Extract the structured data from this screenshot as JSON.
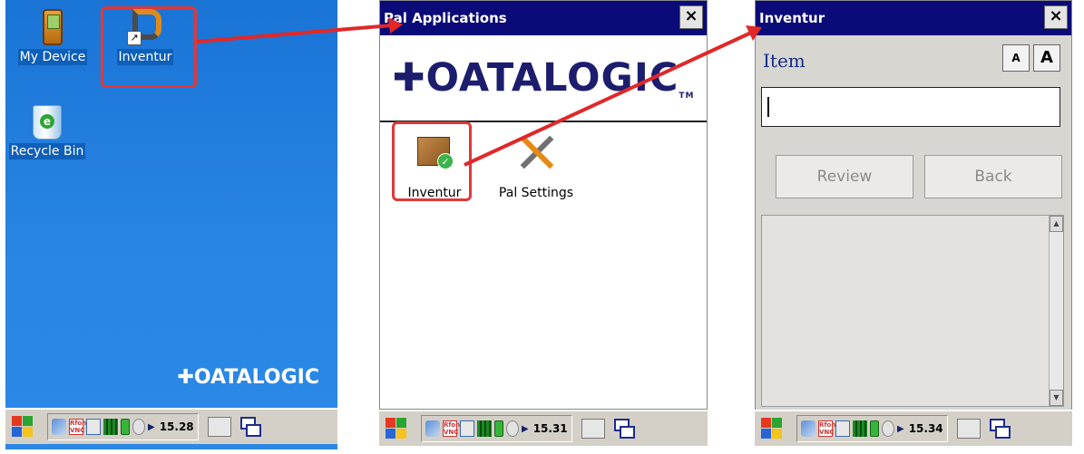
{
  "desktop": {
    "icons": [
      {
        "label": "My Device",
        "icon": "device-icon"
      },
      {
        "label": "Inventur",
        "icon": "inventur-shortcut-icon"
      },
      {
        "label": "Recycle Bin",
        "icon": "recycle-bin-icon"
      }
    ],
    "logo": "✚OATALOGIC",
    "taskbar": {
      "time": "15.28"
    }
  },
  "pal_window": {
    "title": "Pal Applications",
    "title_prefix": "",
    "close": "×",
    "logo": "✚OATALOGIC",
    "logo_tm": "TM",
    "apps": [
      {
        "label": "Inventur",
        "icon": "package-check-icon"
      },
      {
        "label": "Pal Settings",
        "icon": "tools-icon"
      }
    ],
    "taskbar": {
      "time": "15.31"
    }
  },
  "inventur_window": {
    "title": "Inventur",
    "close": "×",
    "item_label": "Item",
    "font_small": "A",
    "font_large": "A",
    "item_value": "",
    "buttons": {
      "review": "Review",
      "back": "Back"
    },
    "taskbar": {
      "time": "15.34"
    }
  },
  "colors": {
    "titlebar": "#0a0a78",
    "highlight": "#e03838",
    "desktop": "#2a86e4"
  }
}
